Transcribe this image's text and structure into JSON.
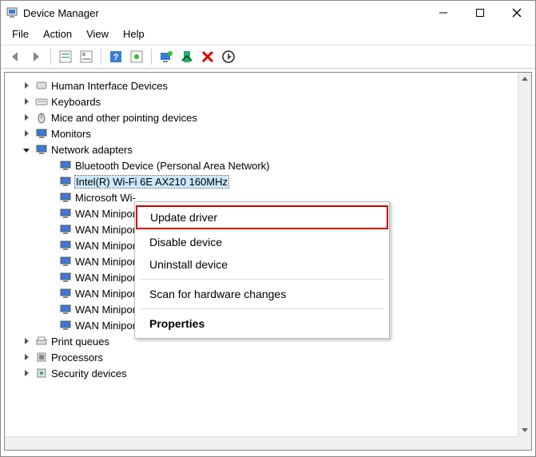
{
  "window": {
    "title": "Device Manager"
  },
  "menu": {
    "file": "File",
    "action": "Action",
    "view": "View",
    "help": "Help"
  },
  "tree": {
    "hid": {
      "label": "Human Interface Devices"
    },
    "keyboards": {
      "label": "Keyboards"
    },
    "mice": {
      "label": "Mice and other pointing devices"
    },
    "monitors": {
      "label": "Monitors"
    },
    "network": {
      "label": "Network adapters"
    },
    "net_children": {
      "bt": "Bluetooth Device (Personal Area Network)",
      "wifi": "Intel(R) Wi-Fi 6E AX210 160MHz",
      "mswifi": "Microsoft Wi-",
      "wm1": "WAN Miniport",
      "wm2": "WAN Miniport",
      "wm3": "WAN Miniport",
      "wm4": "WAN Miniport",
      "wm5": "WAN Miniport",
      "wm6": "WAN Miniport",
      "wm7": "WAN Miniport (PPTP)",
      "wm8": "WAN Miniport (SSTP)"
    },
    "printqueues": {
      "label": "Print queues"
    },
    "processors": {
      "label": "Processors"
    },
    "security": {
      "label": "Security devices"
    }
  },
  "ctxmenu": {
    "update": "Update driver",
    "disable": "Disable device",
    "uninstall": "Uninstall device",
    "scan": "Scan for hardware changes",
    "properties": "Properties"
  }
}
